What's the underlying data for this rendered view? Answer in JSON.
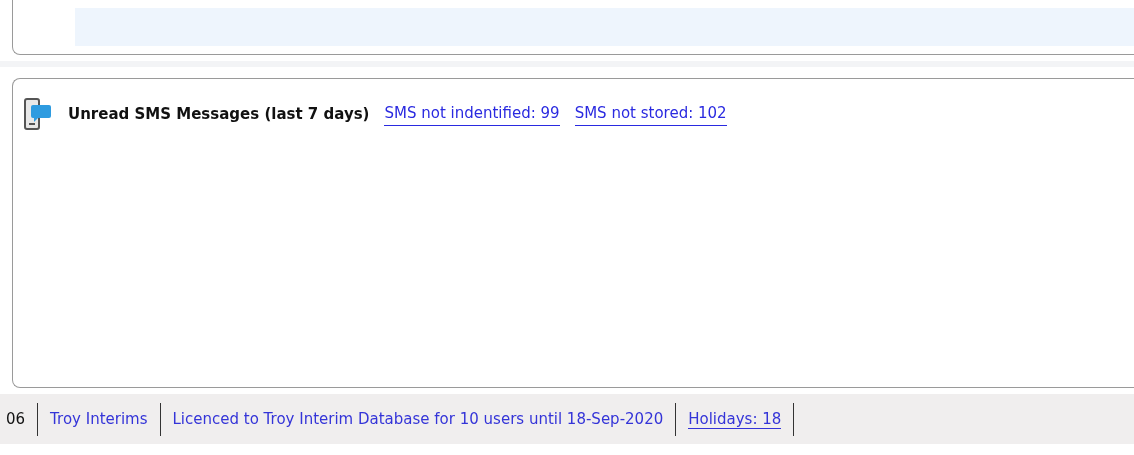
{
  "sms_panel": {
    "title": "Unread SMS Messages (last 7 days)",
    "links": [
      {
        "label": "SMS not indentified: 99"
      },
      {
        "label": "SMS not stored: 102"
      }
    ]
  },
  "status_bar": {
    "items": [
      {
        "kind": "text",
        "label": "06"
      },
      {
        "kind": "info",
        "label": "Troy Interims"
      },
      {
        "kind": "info",
        "label": "Licenced to Troy Interim Database for 10 users until 18-Sep-2020"
      },
      {
        "kind": "link",
        "label": "Holidays: 18"
      }
    ]
  }
}
